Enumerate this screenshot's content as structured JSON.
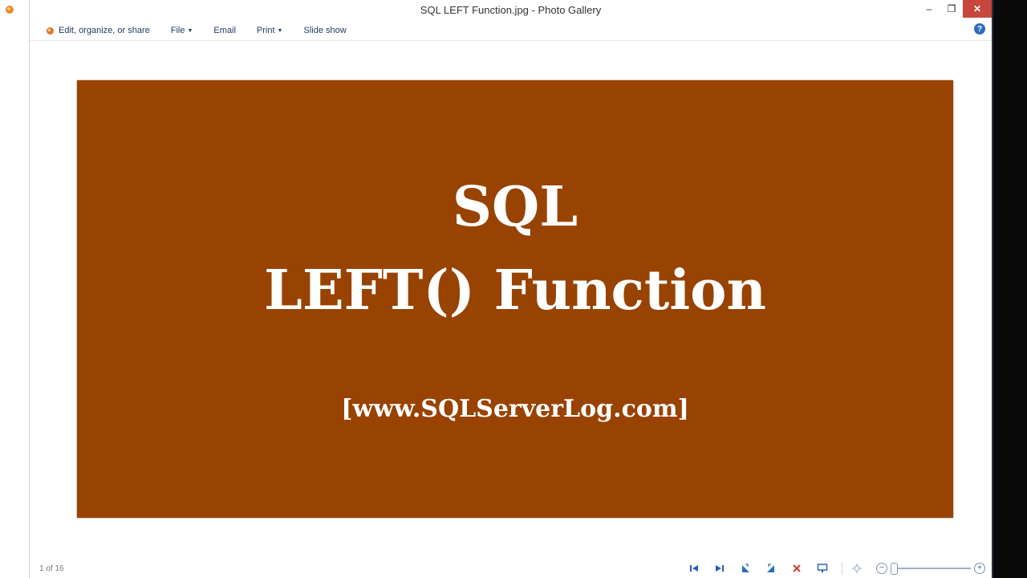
{
  "window": {
    "title": "SQL LEFT Function.jpg - Photo Gallery",
    "controls": {
      "minimize": "–",
      "restore": "❐",
      "close": "✕"
    }
  },
  "toolbar": {
    "edit_label": "Edit, organize, or share",
    "file_label": "File",
    "email_label": "Email",
    "print_label": "Print",
    "slideshow_label": "Slide show",
    "help_label": "?"
  },
  "photo": {
    "background": "#984302",
    "line1": "SQL",
    "line2": "LEFT() Function",
    "line3": "[www.SQLServerLog.com]"
  },
  "status": {
    "counter": "1 of 16"
  },
  "icons": [
    "gallery-app-icon",
    "edit-icon",
    "previous-icon",
    "next-icon",
    "rotate-left-icon",
    "rotate-right-icon",
    "delete-icon",
    "slideshow-icon",
    "actual-size-icon",
    "zoom-out-icon",
    "zoom-in-icon",
    "help-icon"
  ],
  "zoom": {
    "level": 0
  }
}
